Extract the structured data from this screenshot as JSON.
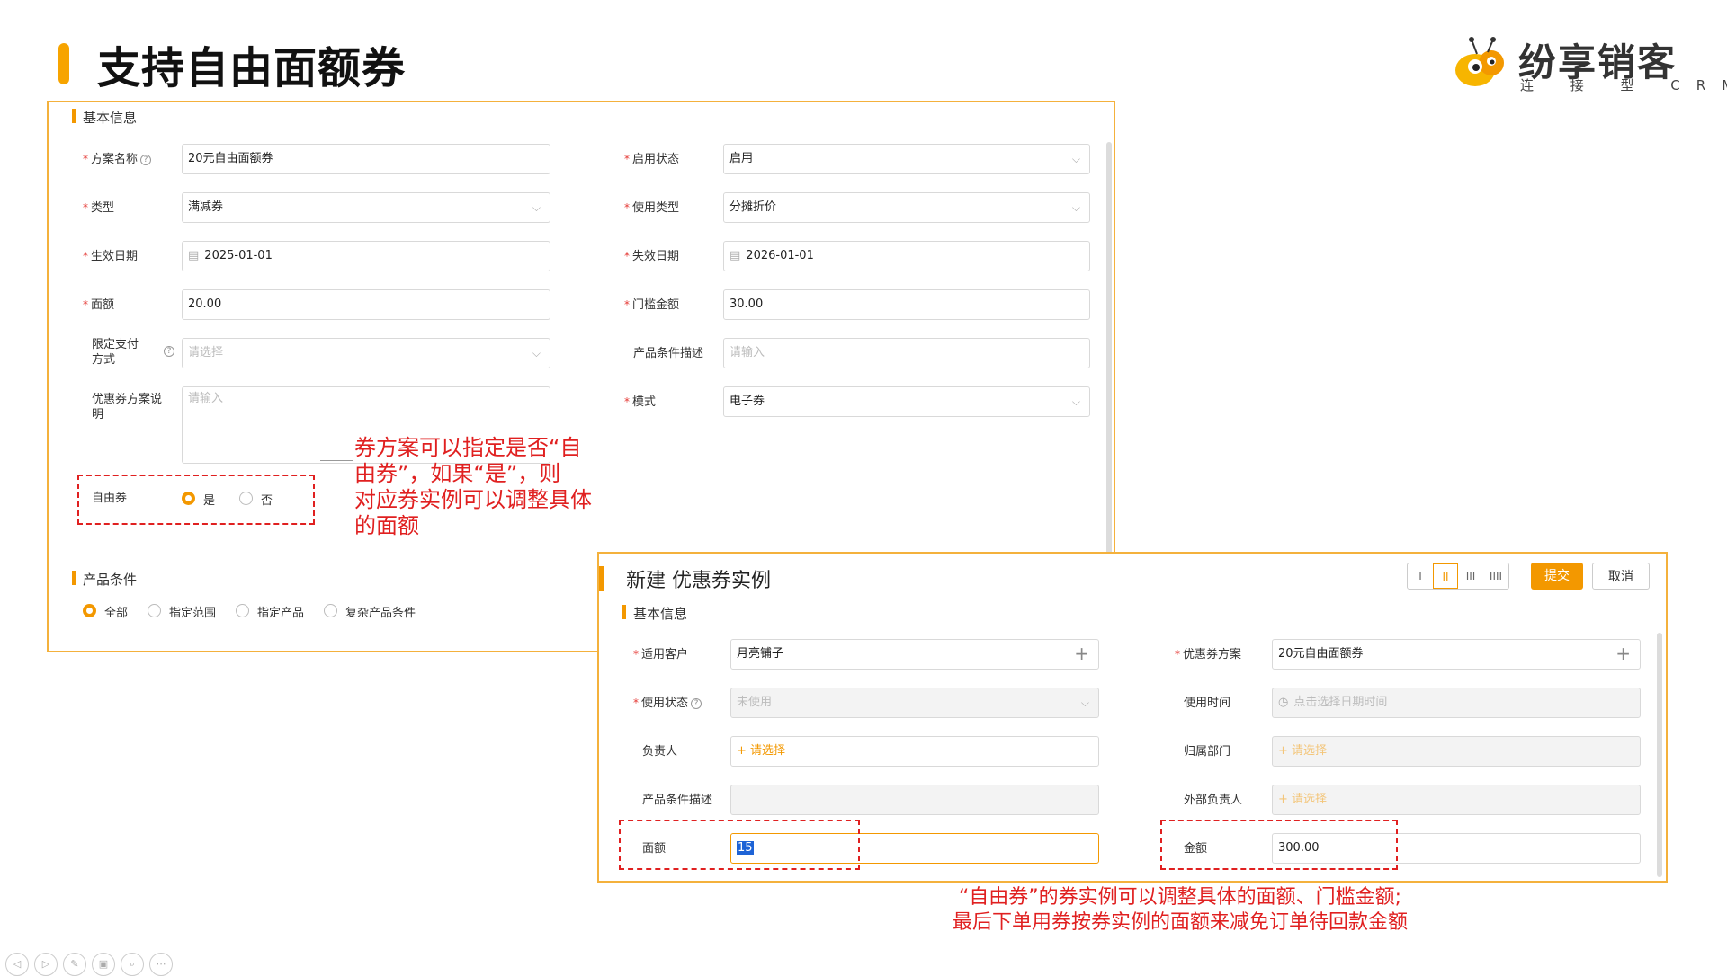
{
  "slide": {
    "title": "支持自由面额券"
  },
  "logo": {
    "name": "纷享销客",
    "sub": "连 接 型 CRM"
  },
  "colors": {
    "accent": "#f39800",
    "annotation": "#e02020",
    "frame": "#f4b13c"
  },
  "form1": {
    "section_basic": "基本信息",
    "section_product": "产品条件",
    "fields": {
      "plan_name": {
        "label": "方案名称",
        "value": "20元自由面额券"
      },
      "type": {
        "label": "类型",
        "value": "满减券"
      },
      "start_date": {
        "label": "生效日期",
        "value": "2025-01-01"
      },
      "face_value": {
        "label": "面额",
        "value": "20.00"
      },
      "pay_method": {
        "label_a": "限定支付",
        "label_b": "方式",
        "placeholder": "请选择"
      },
      "plan_desc": {
        "label_a": "优惠券方案说",
        "label_b": "明",
        "placeholder": "请输入"
      },
      "enable_status": {
        "label": "启用状态",
        "value": "启用"
      },
      "use_type": {
        "label": "使用类型",
        "value": "分摊折价"
      },
      "end_date": {
        "label": "失效日期",
        "value": "2026-01-01"
      },
      "threshold": {
        "label": "门槛金额",
        "value": "30.00"
      },
      "product_desc": {
        "label": "产品条件描述",
        "placeholder": "请输入"
      },
      "mode": {
        "label": "模式",
        "value": "电子券"
      }
    },
    "free_coupon": {
      "label": "自由券",
      "yes": "是",
      "no": "否"
    },
    "product_options": [
      "全部",
      "指定范围",
      "指定产品",
      "复杂产品条件"
    ]
  },
  "annotation1": [
    "券方案可以指定是否“自",
    "由券”，如果“是”，则",
    "对应券实例可以调整具体",
    "的面额"
  ],
  "form2": {
    "title": "新建 优惠券实例",
    "layout_options": [
      "I",
      "II",
      "III",
      "IIII"
    ],
    "submit": "提交",
    "cancel": "取消",
    "section_basic": "基本信息",
    "fields": {
      "customer": {
        "label": "适用客户",
        "value": "月亮铺子"
      },
      "use_status": {
        "label": "使用状态",
        "value": "未使用"
      },
      "owner": {
        "label": "负责人",
        "value": "请选择"
      },
      "product_desc": {
        "label": "产品条件描述",
        "value": ""
      },
      "face_value": {
        "label": "面额",
        "value": "15"
      },
      "coupon_plan": {
        "label": "优惠券方案",
        "value": "20元自由面额券"
      },
      "use_time": {
        "label": "使用时间",
        "placeholder": "点击选择日期时间"
      },
      "department": {
        "label": "归属部门",
        "value": "请选择"
      },
      "ext_owner": {
        "label": "外部负责人",
        "value": "请选择"
      },
      "amount": {
        "label": "金额",
        "value": "300.00"
      }
    }
  },
  "annotation2": [
    "“自由券”的券实例可以调整具体的面额、门槛金额;",
    "最后下单用券按券实例的面额来减免订单待回款金额"
  ],
  "toolbar_icons": [
    "prev-icon",
    "next-icon",
    "pen-icon",
    "slides-icon",
    "zoom-icon",
    "more-icon"
  ]
}
